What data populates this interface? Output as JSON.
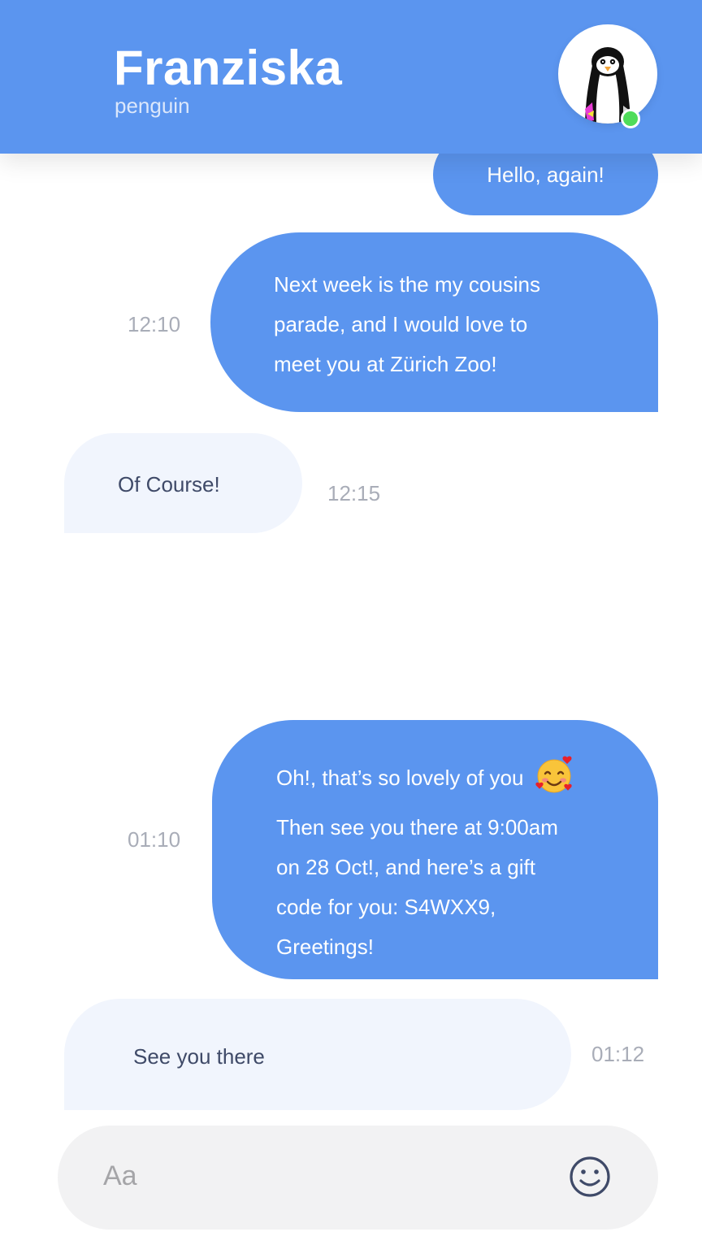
{
  "header": {
    "contact_name": "Franziska",
    "contact_subtitle": "penguin",
    "avatar_icon": "penguin-avatar",
    "online_status_color": "#4fdc5a",
    "background_color": "#5b95ef"
  },
  "messages": [
    {
      "direction": "outgoing",
      "lines": [
        "Hello, again!"
      ],
      "time": ""
    },
    {
      "direction": "outgoing",
      "lines": [
        "Next week is the my cousins",
        "parade, and I would love to",
        "meet you at Zürich Zoo!"
      ],
      "time": "12:10"
    },
    {
      "direction": "incoming",
      "lines": [
        "Of Course!"
      ],
      "time": "12:15"
    },
    {
      "direction": "outgoing",
      "lines": [
        "Oh!, that’s so lovely of you",
        "Then see you there at 9:00am",
        "on 28 Oct!, and here’s a gift",
        "code for you: S4WXX9,",
        "Greetings!"
      ],
      "emoji": "smiling-face-with-hearts",
      "time": "01:10"
    },
    {
      "direction": "incoming",
      "lines": [
        "See you there"
      ],
      "time": "01:12"
    }
  ],
  "composer": {
    "placeholder": "Aa",
    "value": "",
    "emoji_button_icon": "smiley-icon"
  },
  "colors": {
    "outgoing_bubble": "#5b95ef",
    "incoming_bubble": "#f1f5fd",
    "incoming_text": "#3f4a68",
    "timestamp": "#a9adb8"
  }
}
